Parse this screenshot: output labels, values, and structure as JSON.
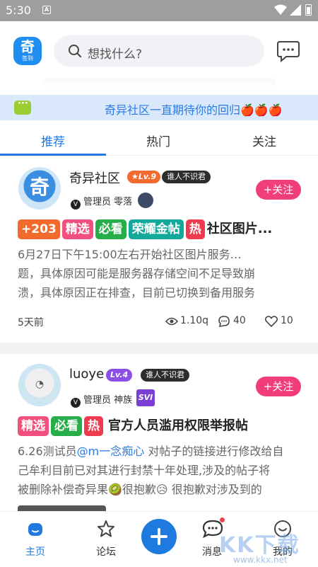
{
  "status_bar": {
    "time": "5:30",
    "notif_icon_label": "A"
  },
  "header": {
    "logo_big": "奇",
    "logo_small": "签到",
    "search_placeholder": "想找什么?"
  },
  "banner": {
    "text": "奇异社区一直期待你的回归🍎🍎🍎"
  },
  "tabs": [
    {
      "label": "推荐"
    },
    {
      "label": "热门"
    },
    {
      "label": "关注"
    }
  ],
  "posts": [
    {
      "avatar_char": "奇",
      "username": "奇异社区",
      "level": "★Lv.9",
      "title_badge": "谁人不识君",
      "role": "管理员 零落",
      "follow_label": "+关注",
      "tags": [
        "+203",
        "精选",
        "必看",
        "荣耀金帖",
        "热"
      ],
      "title": "社区图片...",
      "body_lines": [
        "6月27日下午15:00左右开始社区图片服务…",
        "题，具体原因可能是服务器存储空间不足导致崩",
        "溃，具体原因正在排查，目前已切换到备用服务"
      ],
      "time": "5天前",
      "views": "1.10q",
      "comments": "40",
      "likes": "10"
    },
    {
      "avatar_char": "◔",
      "username": "luoye",
      "level": "Lv.4",
      "title_badge": "谁人不识君",
      "role": "管理员 神族",
      "badge_svi": "SVI",
      "follow_label": "+关注",
      "tags": [
        "精选",
        "必看",
        "热"
      ],
      "title": "官方人员滥用权限举报帖",
      "body_line1_a": "6.26测试员",
      "body_line1_mention": "@m一念痴心",
      "body_line1_b": " 对帖子的链接进行修改给自",
      "body_line2": "己牟利目前已对其进行封禁十年处理,涉及的帖子将",
      "body_line3": "被删除补偿奇异果🥝很抱歉😥 很抱歉对涉及到的"
    }
  ],
  "bottom_nav": [
    {
      "label": "主页"
    },
    {
      "label": "论坛"
    },
    {
      "label": "消息"
    },
    {
      "label": "我的"
    }
  ],
  "watermark": {
    "main": "KK下载",
    "url": "www.kkx.net"
  },
  "colors": {
    "accent": "#1f7ae0",
    "follow": "#f23e78",
    "banner_bg": "#d9e8fb"
  }
}
